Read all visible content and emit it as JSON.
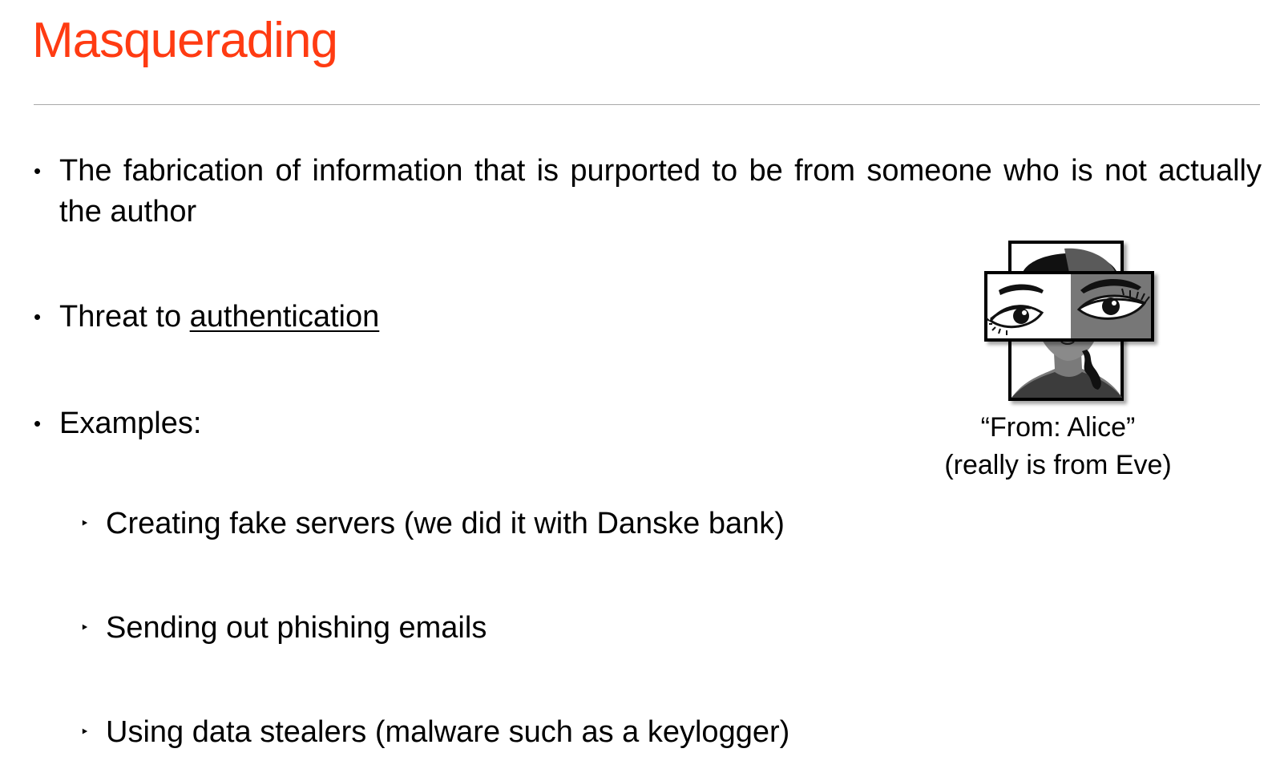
{
  "slide": {
    "title": "Masquerading",
    "bullets": [
      "The fabrication of information that is purported to be from someone who is not actually the author",
      "Examples:"
    ],
    "threat": {
      "prefix": "Threat to ",
      "link": "authentication"
    },
    "sub_bullets": [
      "Creating fake servers (we did it with Danske bank)",
      "Sending out phishing emails",
      "Using data stealers (malware such as a keylogger)"
    ],
    "bullet_glyph": "•",
    "sub_bullet_glyph": "‣",
    "accent_color": "#ff3b12"
  },
  "figure": {
    "icon": "masked-face-icon",
    "caption_line1": "“From: Alice”",
    "caption_line2": "(really is from Eve)"
  }
}
